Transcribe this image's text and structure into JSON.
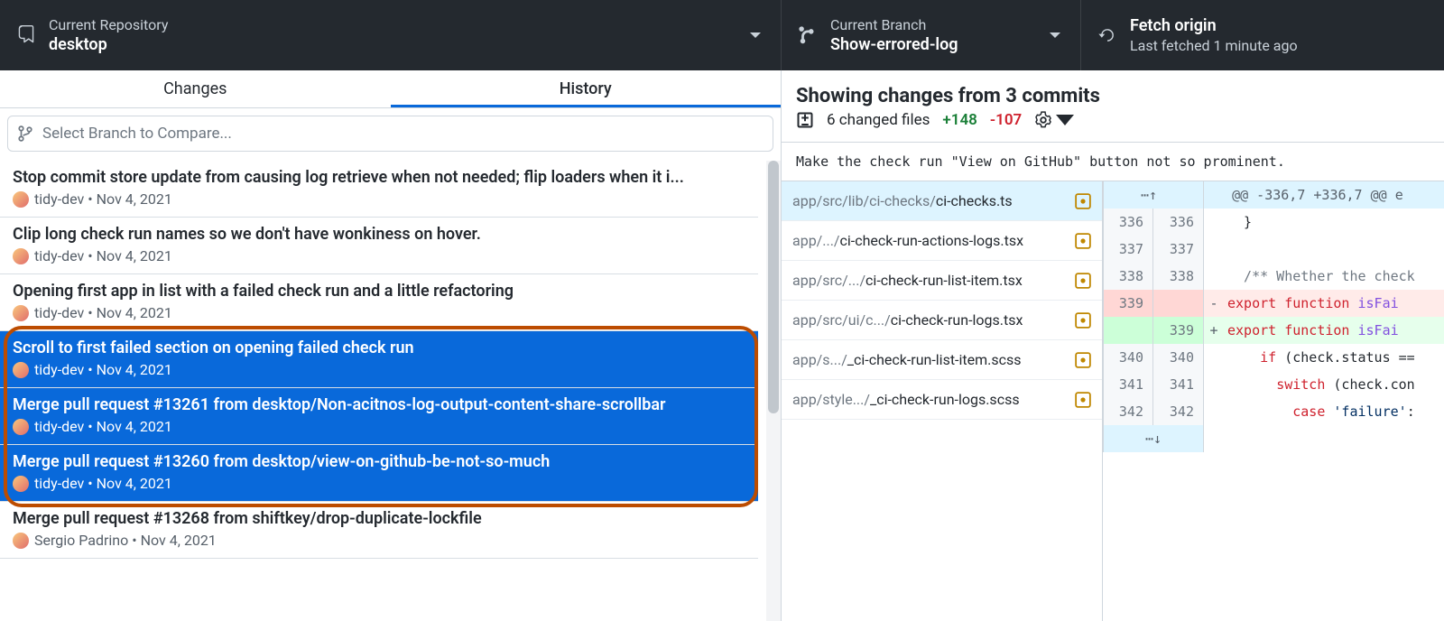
{
  "toolbar": {
    "repo": {
      "label": "Current Repository",
      "value": "desktop"
    },
    "branch": {
      "label": "Current Branch",
      "value": "Show-errored-log"
    },
    "fetch": {
      "label": "Fetch origin",
      "value": "Last fetched 1 minute ago"
    }
  },
  "tabs": {
    "changes": "Changes",
    "history": "History"
  },
  "branch_compare_placeholder": "Select Branch to Compare...",
  "commits": [
    {
      "title": "Stop commit store update from causing log retrieve when not needed; flip loaders when it i...",
      "author": "tidy-dev",
      "date": "Nov 4, 2021",
      "selected": false
    },
    {
      "title": "Clip long check run names so we don't have wonkiness on hover.",
      "author": "tidy-dev",
      "date": "Nov 4, 2021",
      "selected": false
    },
    {
      "title": "Opening first app in list with a failed check run and a little refactoring",
      "author": "tidy-dev",
      "date": "Nov 4, 2021",
      "selected": false
    },
    {
      "title": "Scroll to first failed section on opening failed check run",
      "author": "tidy-dev",
      "date": "Nov 4, 2021",
      "selected": true
    },
    {
      "title": "Merge pull request #13261 from desktop/Non-acitnos-log-output-content-share-scrollbar",
      "author": "tidy-dev",
      "date": "Nov 4, 2021",
      "selected": true
    },
    {
      "title": "Merge pull request #13260 from desktop/view-on-github-be-not-so-much",
      "author": "tidy-dev",
      "date": "Nov 4, 2021",
      "selected": true
    },
    {
      "title": "Merge pull request #13268 from shiftkey/drop-duplicate-lockfile",
      "author": "Sergio Padrino",
      "date": "Nov 4, 2021",
      "selected": false
    }
  ],
  "changes_header": "Showing changes from 3 commits",
  "changes_sub": {
    "files_text": "6 changed files",
    "additions": "+148",
    "deletions": "-107"
  },
  "commit_message": "Make the check run \"View on GitHub\" button not so prominent.",
  "files": [
    {
      "dim": "app/src/lib/ci-checks/",
      "name": "ci-checks.ts",
      "active": true
    },
    {
      "dim": "app/.../",
      "name": "ci-check-run-actions-logs.tsx",
      "active": false
    },
    {
      "dim": "app/src/.../",
      "name": "ci-check-run-list-item.tsx",
      "active": false
    },
    {
      "dim": "app/src/ui/c.../",
      "name": "ci-check-run-logs.tsx",
      "active": false
    },
    {
      "dim": "app/s.../",
      "name": "_ci-check-run-list-item.scss",
      "active": false
    },
    {
      "dim": "app/style.../",
      "name": "_ci-check-run-logs.scss",
      "active": false
    }
  ],
  "diff": {
    "hunk_header": "@@ -336,7 +336,7 @@ e",
    "lines": [
      {
        "type": "ctx",
        "old": "336",
        "new": "336",
        "code_html": "<span class='plain'>  }</span>"
      },
      {
        "type": "ctx",
        "old": "337",
        "new": "337",
        "code_html": ""
      },
      {
        "type": "ctx",
        "old": "338",
        "new": "338",
        "code_html": "<span class='cmt'>  /** Whether the check</span>"
      },
      {
        "type": "del",
        "old": "339",
        "new": "",
        "code_html": "<span class='kw'>export function</span> <span class='fn'>isFai</span>"
      },
      {
        "type": "add",
        "old": "",
        "new": "339",
        "code_html": "<span class='kw'>export function</span> <span class='fn'>isFai</span>"
      },
      {
        "type": "ctx",
        "old": "340",
        "new": "340",
        "code_html": "<span class='plain'>    </span><span class='kw'>if</span><span class='plain'> (check.status ==</span>"
      },
      {
        "type": "ctx",
        "old": "341",
        "new": "341",
        "code_html": "<span class='plain'>      </span><span class='kw'>switch</span><span class='plain'> (check.con</span>"
      },
      {
        "type": "ctx",
        "old": "342",
        "new": "342",
        "code_html": "<span class='plain'>        </span><span class='kw'>case</span><span class='plain'> </span><span class='str'>'failure'</span><span class='plain'>:</span>"
      }
    ]
  }
}
